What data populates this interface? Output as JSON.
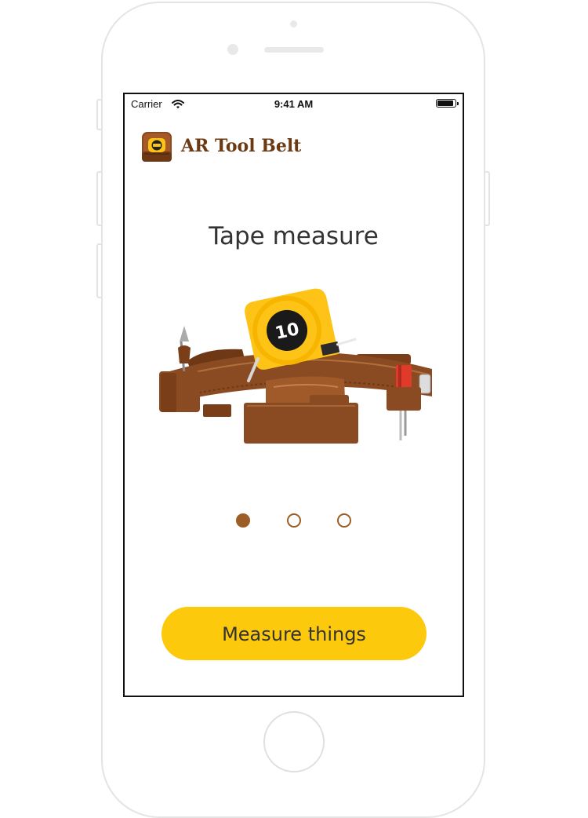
{
  "status_bar": {
    "carrier": "Carrier",
    "time": "9:41 AM",
    "icons": [
      "wifi-icon",
      "battery-icon"
    ]
  },
  "app": {
    "title": "AR Tool Belt",
    "icon": "tool-belt-app-icon"
  },
  "onboarding": {
    "slide_title": "Tape measure",
    "illustration": "tool-belt-with-tape-measure",
    "tape_measure_number": "10",
    "pages": [
      {
        "state": "active"
      },
      {
        "state": "inactive"
      },
      {
        "state": "inactive"
      }
    ],
    "cta_label": "Measure things"
  },
  "colors": {
    "brand_brown": "#6b3a12",
    "dot_brown": "#9c5d26",
    "cta_yellow": "#fcc90c",
    "belt_leather": "#8b4b22",
    "tape_yellow": "#fdc316"
  }
}
